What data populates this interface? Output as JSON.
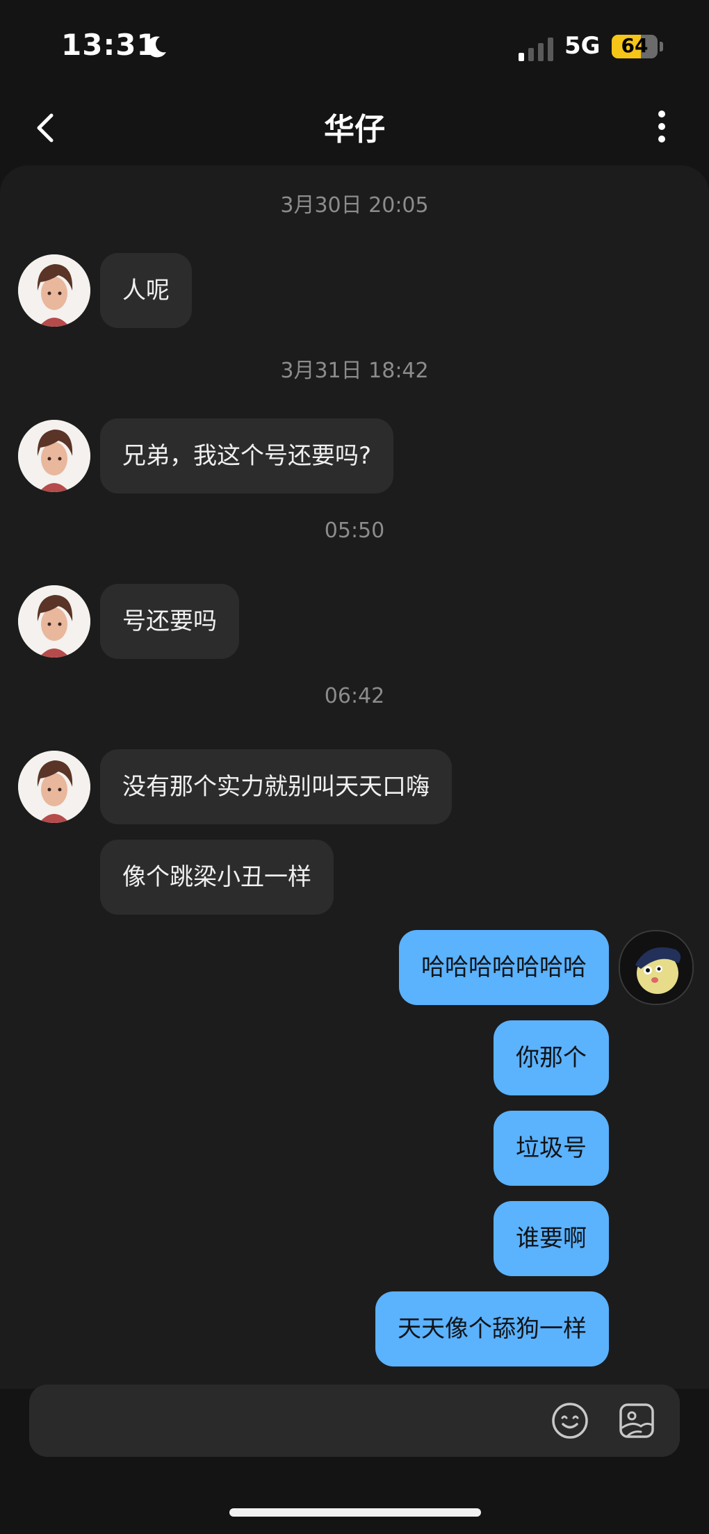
{
  "status": {
    "time": "13:31",
    "network": "5G",
    "battery": "64",
    "battery_level": 0.64
  },
  "header": {
    "title": "华仔"
  },
  "timestamps": [
    "3月30日 20:05",
    "3月31日 18:42",
    "05:50",
    "06:42"
  ],
  "messages_in": [
    "人呢",
    "兄弟，我这个号还要吗?",
    "号还要吗",
    "没有那个实力就别叫天天口嗨",
    "像个跳梁小丑一样"
  ],
  "messages_out": [
    "哈哈哈哈哈哈哈",
    "你那个",
    "垃圾号",
    "谁要啊",
    "天天像个舔狗一样"
  ],
  "icons": {
    "moon": "moon-icon",
    "signal": "signal-icon",
    "back": "chevron-left-icon",
    "more": "more-vertical-icon",
    "emoji": "emoji-icon",
    "sticker": "sticker-icon"
  },
  "colors": {
    "outgoing_bubble": "#5bb2fd",
    "incoming_bubble": "#2c2c2c",
    "battery": "#f5c518"
  }
}
